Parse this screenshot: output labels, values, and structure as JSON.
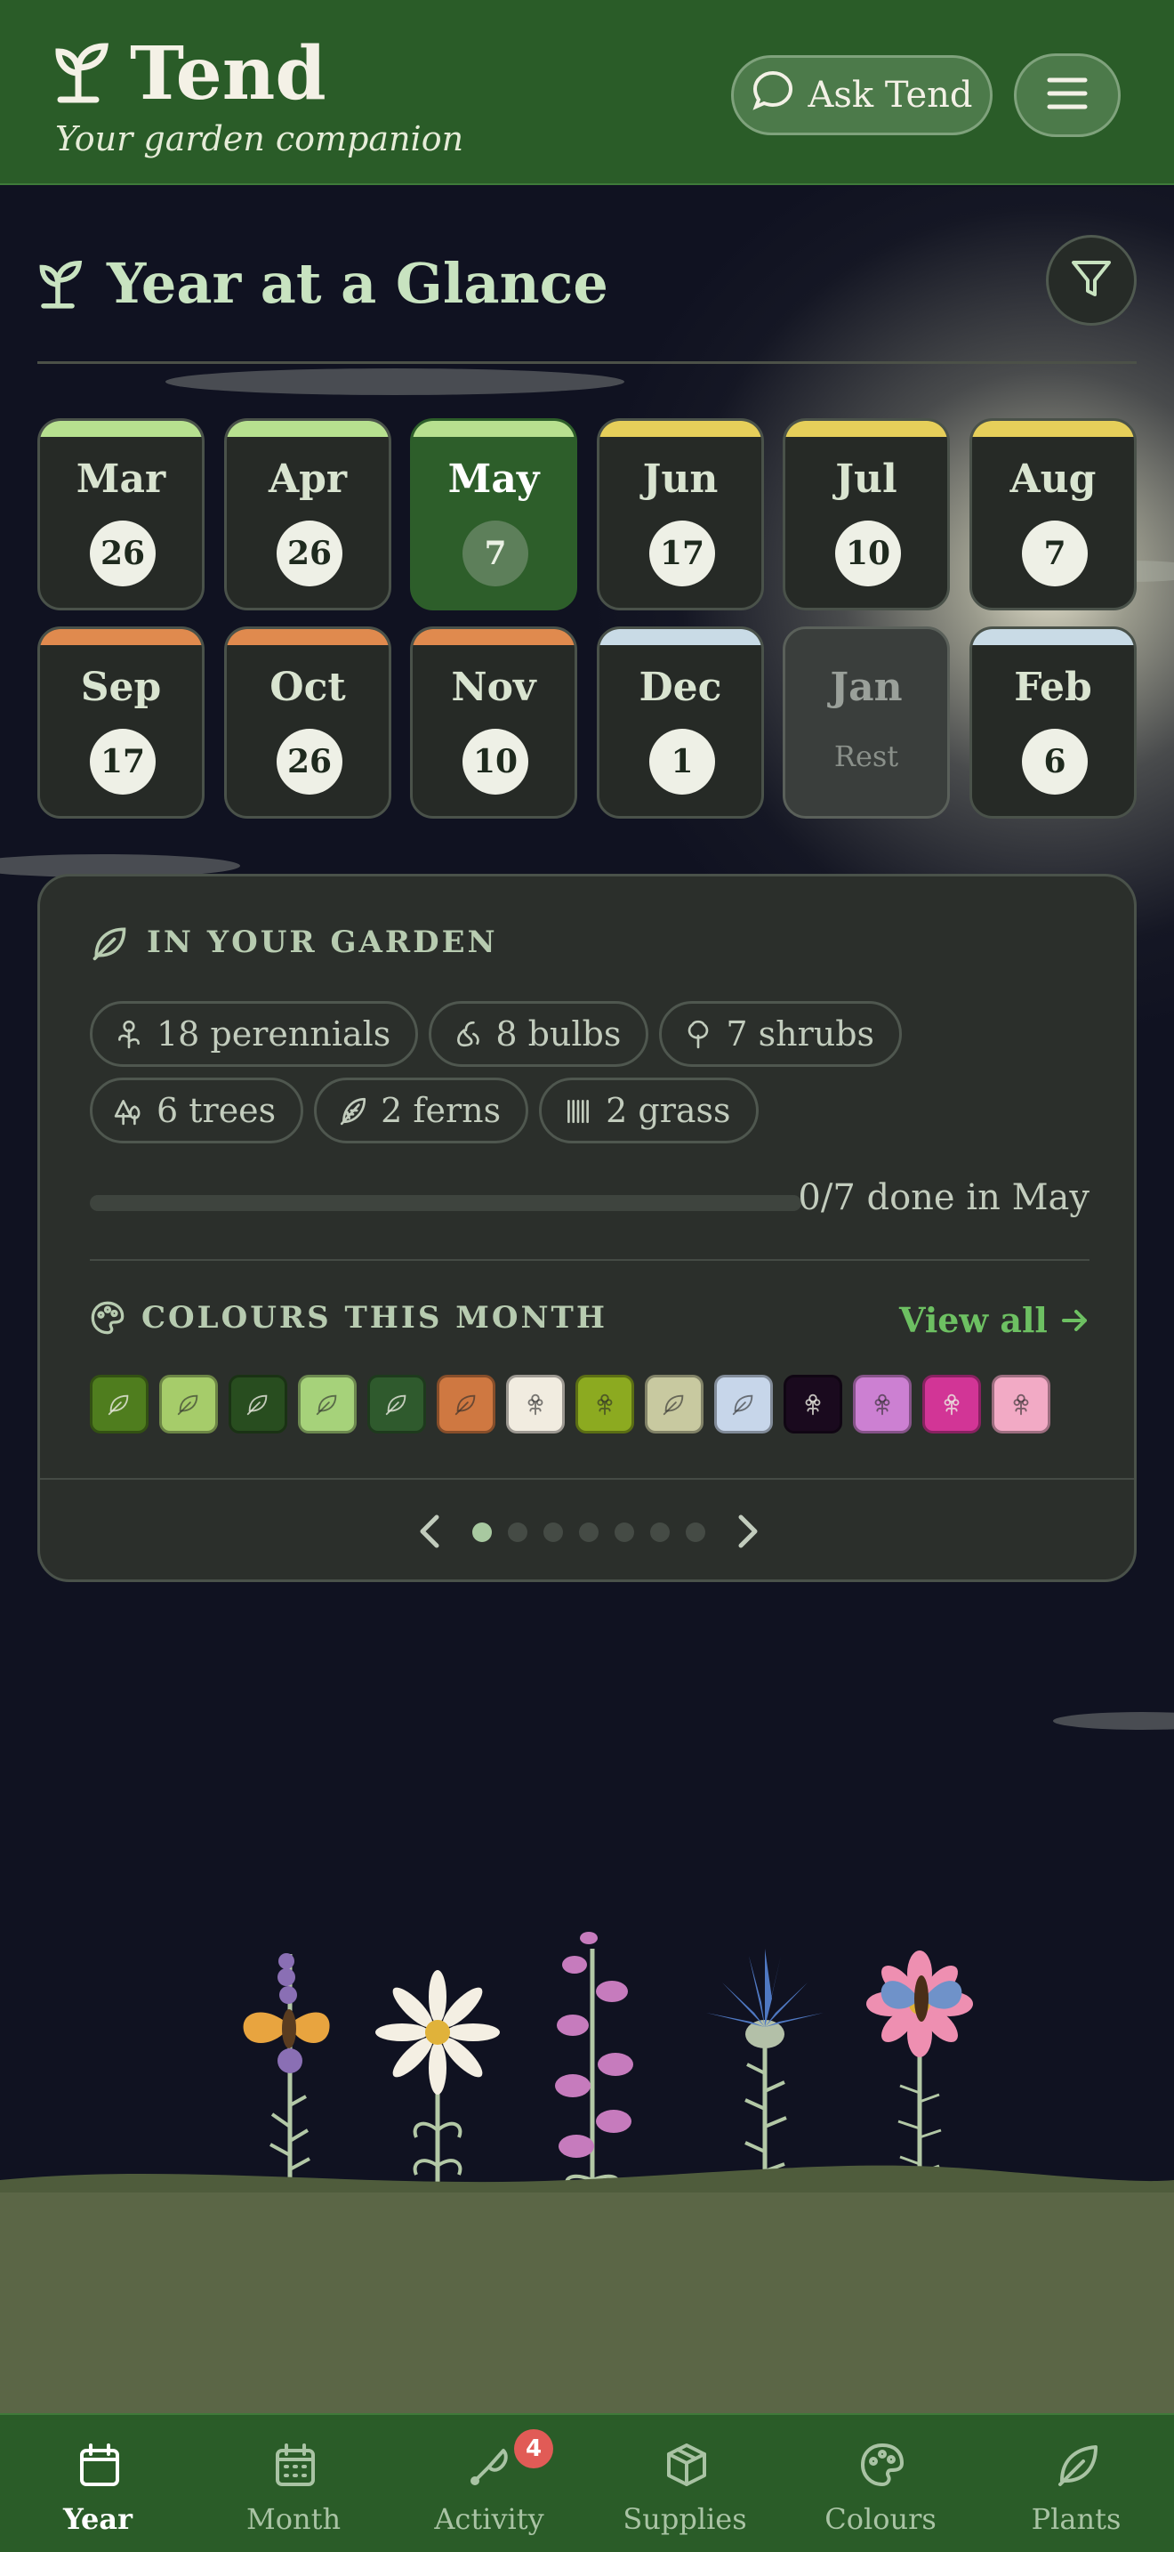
{
  "header": {
    "title": "Tend",
    "subtitle": "Your garden companion",
    "ask_label": "Ask Tend"
  },
  "section": {
    "title": "Year at a Glance"
  },
  "months": [
    {
      "name": "Mar",
      "count": "26",
      "season_color": "#b7e08f",
      "state": "normal"
    },
    {
      "name": "Apr",
      "count": "26",
      "season_color": "#b7e08f",
      "state": "normal"
    },
    {
      "name": "May",
      "count": "7",
      "season_color": "#b7e08f",
      "state": "active"
    },
    {
      "name": "Jun",
      "count": "17",
      "season_color": "#e6cf5a",
      "state": "normal"
    },
    {
      "name": "Jul",
      "count": "10",
      "season_color": "#e6cf5a",
      "state": "normal"
    },
    {
      "name": "Aug",
      "count": "7",
      "season_color": "#e6cf5a",
      "state": "normal"
    },
    {
      "name": "Sep",
      "count": "17",
      "season_color": "#e08a4e",
      "state": "normal"
    },
    {
      "name": "Oct",
      "count": "26",
      "season_color": "#e08a4e",
      "state": "normal"
    },
    {
      "name": "Nov",
      "count": "10",
      "season_color": "#e08a4e",
      "state": "normal"
    },
    {
      "name": "Dec",
      "count": "1",
      "season_color": "#c9dbe6",
      "state": "normal"
    },
    {
      "name": "Jan",
      "count": "",
      "rest_label": "Rest",
      "season_color": "#c9dbe6",
      "state": "rest"
    },
    {
      "name": "Feb",
      "count": "6",
      "season_color": "#c9dbe6",
      "state": "normal"
    }
  ],
  "garden": {
    "heading": "IN YOUR GARDEN",
    "chips": [
      {
        "label": "18 perennials",
        "icon": "flower-stem-icon"
      },
      {
        "label": "8 bulbs",
        "icon": "bulb-icon"
      },
      {
        "label": "7 shrubs",
        "icon": "shrub-icon"
      },
      {
        "label": "6 trees",
        "icon": "trees-icon"
      },
      {
        "label": "2 ferns",
        "icon": "fern-icon"
      },
      {
        "label": "2 grass",
        "icon": "grass-icon"
      }
    ],
    "progress_text": "0/7 done in May",
    "progress_fraction": 0,
    "colours_heading": "COLOURS THIS MONTH",
    "view_all": "View all",
    "swatches": [
      {
        "color": "#4f7d1e",
        "icon": "leaf-icon"
      },
      {
        "color": "#a6cc6a",
        "icon": "leaf-icon"
      },
      {
        "color": "#284d1f",
        "icon": "leaf-icon"
      },
      {
        "color": "#a6d27a",
        "icon": "leaf-icon"
      },
      {
        "color": "#2f5a2d",
        "icon": "leaf-icon"
      },
      {
        "color": "#cf7841",
        "icon": "leaf-icon"
      },
      {
        "color": "#f1ece0",
        "icon": "flower-icon"
      },
      {
        "color": "#8caa20",
        "icon": "flower-icon"
      },
      {
        "color": "#c8c9a0",
        "icon": "leaf-icon"
      },
      {
        "color": "#c7d6ea",
        "icon": "leaf-icon"
      },
      {
        "color": "#1a0a1e",
        "icon": "flower-icon"
      },
      {
        "color": "#cc80d2",
        "icon": "flower-icon"
      },
      {
        "color": "#d23596",
        "icon": "flower-icon"
      },
      {
        "color": "#f2aac5",
        "icon": "flower-icon"
      }
    ],
    "pager": {
      "pages": 7,
      "current": 1
    }
  },
  "nav": [
    {
      "label": "Year",
      "icon": "calendar-icon",
      "active": true
    },
    {
      "label": "Month",
      "icon": "calendar-grid-icon",
      "active": false
    },
    {
      "label": "Activity",
      "icon": "trowel-icon",
      "active": false,
      "badge": "4"
    },
    {
      "label": "Supplies",
      "icon": "box-icon",
      "active": false
    },
    {
      "label": "Colours",
      "icon": "palette-icon",
      "active": false
    },
    {
      "label": "Plants",
      "icon": "leaf-icon",
      "active": false
    }
  ]
}
